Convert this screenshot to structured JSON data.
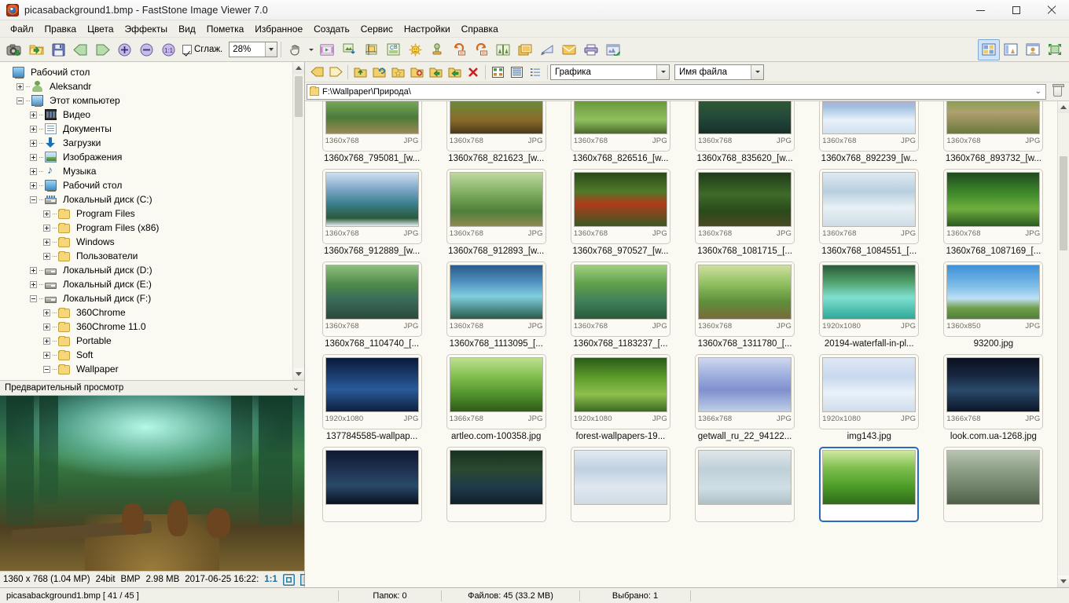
{
  "window": {
    "title": "picasabackground1.bmp  -  FastStone Image Viewer 7.0",
    "app_icon": "camera-icon",
    "minimize_label": "Minimize",
    "maximize_label": "Maximize",
    "close_label": "Close"
  },
  "menubar": {
    "items": [
      {
        "label": "Файл",
        "name": "menu-file"
      },
      {
        "label": "Правка",
        "name": "menu-edit"
      },
      {
        "label": "Цвета",
        "name": "menu-colors"
      },
      {
        "label": "Эффекты",
        "name": "menu-effects"
      },
      {
        "label": "Вид",
        "name": "menu-view"
      },
      {
        "label": "Пометка",
        "name": "menu-tag"
      },
      {
        "label": "Избранное",
        "name": "menu-favorites"
      },
      {
        "label": "Создать",
        "name": "menu-create"
      },
      {
        "label": "Сервис",
        "name": "menu-tools"
      },
      {
        "label": "Настройки",
        "name": "menu-settings"
      },
      {
        "label": "Справка",
        "name": "menu-help"
      }
    ]
  },
  "toolbar": {
    "buttons": [
      {
        "name": "screen-capture-icon",
        "tip": "Захват экрана"
      },
      {
        "name": "open-folder-icon",
        "tip": "Открыть"
      },
      {
        "name": "save-icon",
        "tip": "Сохранить"
      },
      {
        "name": "previous-icon",
        "tip": "Предыдущее"
      },
      {
        "name": "next-icon",
        "tip": "Следующее"
      },
      {
        "name": "zoom-in-icon",
        "tip": "Увеличить"
      },
      {
        "name": "zoom-out-icon",
        "tip": "Уменьшить"
      },
      {
        "name": "actual-size-icon",
        "tip": "Реальный размер"
      }
    ],
    "smooth_checkbox": {
      "label": "Сглаж.",
      "checked": true
    },
    "zoom_value": "28%",
    "buttons2": [
      {
        "name": "pan-hand-icon",
        "tip": "Панорама"
      },
      {
        "name": "slideshow-icon",
        "tip": "Слайд-шоу"
      },
      {
        "name": "resize-icon",
        "tip": "Изменить размер"
      },
      {
        "name": "crop-icon",
        "tip": "Обрезка"
      },
      {
        "name": "color-adjust-icon",
        "tip": "Коррекция цвета"
      },
      {
        "name": "brightness-icon",
        "tip": "Яркость"
      },
      {
        "name": "clone-stamp-icon",
        "tip": "Штамп"
      },
      {
        "name": "rotate-left-icon",
        "tip": "Повернуть влево"
      },
      {
        "name": "rotate-right-icon",
        "tip": "Повернуть вправо"
      },
      {
        "name": "compare-icon",
        "tip": "Сравнить"
      },
      {
        "name": "frame-icon",
        "tip": "Рамка"
      },
      {
        "name": "draw-icon",
        "tip": "Рисование"
      },
      {
        "name": "email-icon",
        "tip": "Отправить по почте"
      },
      {
        "name": "print-icon",
        "tip": "Печать"
      },
      {
        "name": "edit-external-icon",
        "tip": "Внешний редактор"
      }
    ],
    "view_modes": [
      {
        "name": "view-thumbnails-icon",
        "tip": "Эскизы",
        "active": true
      },
      {
        "name": "view-filmstrip-icon",
        "tip": "Плёнка",
        "active": false
      },
      {
        "name": "view-preview-icon",
        "tip": "Просмотр",
        "active": false
      },
      {
        "name": "fullscreen-icon",
        "tip": "Полный экран",
        "active": false
      }
    ]
  },
  "tree": {
    "nodes": [
      {
        "label": "Рабочий стол",
        "depth": 0,
        "icon": "desktop-icon",
        "toggle": "none"
      },
      {
        "label": "Aleksandr",
        "depth": 1,
        "icon": "user-icon",
        "toggle": "plus"
      },
      {
        "label": "Этот компьютер",
        "depth": 1,
        "icon": "computer-icon",
        "toggle": "minus"
      },
      {
        "label": "Видео",
        "depth": 2,
        "icon": "video-icon",
        "toggle": "plus"
      },
      {
        "label": "Документы",
        "depth": 2,
        "icon": "documents-icon",
        "toggle": "plus"
      },
      {
        "label": "Загрузки",
        "depth": 2,
        "icon": "downloads-icon",
        "toggle": "plus"
      },
      {
        "label": "Изображения",
        "depth": 2,
        "icon": "pictures-icon",
        "toggle": "plus"
      },
      {
        "label": "Музыка",
        "depth": 2,
        "icon": "music-icon",
        "toggle": "plus"
      },
      {
        "label": "Рабочий стол",
        "depth": 2,
        "icon": "desktop-icon",
        "toggle": "plus"
      },
      {
        "label": "Локальный диск (C:)",
        "depth": 2,
        "icon": "drive-system-icon",
        "toggle": "minus"
      },
      {
        "label": "Program Files",
        "depth": 3,
        "icon": "folder-icon",
        "toggle": "plus"
      },
      {
        "label": "Program Files (x86)",
        "depth": 3,
        "icon": "folder-icon",
        "toggle": "plus"
      },
      {
        "label": "Windows",
        "depth": 3,
        "icon": "folder-icon",
        "toggle": "plus"
      },
      {
        "label": "Пользователи",
        "depth": 3,
        "icon": "folder-icon",
        "toggle": "plus"
      },
      {
        "label": "Локальный диск (D:)",
        "depth": 2,
        "icon": "drive-icon",
        "toggle": "plus"
      },
      {
        "label": "Локальный диск (E:)",
        "depth": 2,
        "icon": "drive-icon",
        "toggle": "plus"
      },
      {
        "label": "Локальный диск (F:)",
        "depth": 2,
        "icon": "drive-icon",
        "toggle": "minus"
      },
      {
        "label": "360Chrome",
        "depth": 3,
        "icon": "folder-icon",
        "toggle": "plus"
      },
      {
        "label": "360Chrome 11.0",
        "depth": 3,
        "icon": "folder-icon",
        "toggle": "plus"
      },
      {
        "label": "Portable",
        "depth": 3,
        "icon": "folder-icon",
        "toggle": "plus"
      },
      {
        "label": "Soft",
        "depth": 3,
        "icon": "folder-icon",
        "toggle": "plus"
      },
      {
        "label": "Wallpaper",
        "depth": 3,
        "icon": "folder-icon",
        "toggle": "minus"
      }
    ]
  },
  "preview": {
    "header_label": "Предварительный просмотр",
    "collapse_icon": "double-chevron-down-icon",
    "status": {
      "dimensions": "1360 x 768 (1.04 MP)",
      "depth": "24bit",
      "format": "BMP",
      "size": "2.98 MB",
      "date": "2017-06-25 16:22:",
      "ratio": "1:1",
      "fit_icon": "fit-window-icon",
      "full_icon": "full-size-icon"
    }
  },
  "browser": {
    "nav_buttons": [
      {
        "name": "back-arrow-icon",
        "tip": "Назад"
      },
      {
        "name": "forward-arrow-icon",
        "tip": "Вперёд"
      }
    ],
    "folder_buttons": [
      {
        "name": "folder-up-icon",
        "tip": "Вверх"
      },
      {
        "name": "folder-refresh-icon",
        "tip": "Обновить"
      },
      {
        "name": "folder-favorite-icon",
        "tip": "Избранная папка"
      },
      {
        "name": "folder-new-icon",
        "tip": "Новая папка"
      },
      {
        "name": "folder-copy-to-icon",
        "tip": "Копировать в"
      },
      {
        "name": "folder-move-to-icon",
        "tip": "Переместить в"
      }
    ],
    "delete_x_icon": "delete-x-icon",
    "list_buttons": [
      {
        "name": "view-grid-icon",
        "tip": "Эскизы"
      },
      {
        "name": "view-list-icon",
        "tip": "Список"
      },
      {
        "name": "view-details-icon",
        "tip": "Подробно"
      }
    ],
    "filter_combo": {
      "value": "Графика",
      "name": "file-type-filter"
    },
    "sort_combo": {
      "value": "Имя файла",
      "name": "sort-order-select"
    },
    "address": {
      "value": "F:\\Wallpaper\\Природа\\",
      "folder_icon": "folder-icon",
      "dropdown_icon": "chevron-down-icon"
    },
    "delete_button": {
      "name": "delete-button",
      "icon": "trash-icon"
    }
  },
  "thumbnails": [
    {
      "size": "1360x768",
      "type": "JPG",
      "name": "1360x768_795081_[w...",
      "selected": false,
      "art": "path-forest"
    },
    {
      "size": "1360x768",
      "type": "JPG",
      "name": "1360x768_821623_[w...",
      "selected": false,
      "art": "mushroom-forest"
    },
    {
      "size": "1360x768",
      "type": "JPG",
      "name": "1360x768_826516_[w...",
      "selected": false,
      "art": "green-park"
    },
    {
      "size": "1360x768",
      "type": "JPG",
      "name": "1360x768_835620_[w...",
      "selected": false,
      "art": "dark-lake"
    },
    {
      "size": "1360x768",
      "type": "JPG",
      "name": "1360x768_892239_[w...",
      "selected": false,
      "art": "winter-pink-sky"
    },
    {
      "size": "1360x768",
      "type": "JPG",
      "name": "1360x768_893732_[w...",
      "selected": false,
      "art": "stone-cottage"
    },
    {
      "size": "1360x768",
      "type": "JPG",
      "name": "1360x768_912889_[w...",
      "selected": false,
      "art": "snow-lake-pine"
    },
    {
      "size": "1360x768",
      "type": "JPG",
      "name": "1360x768_912893_[w...",
      "selected": false,
      "art": "green-road"
    },
    {
      "size": "1360x768",
      "type": "JPG",
      "name": "1360x768_970527_[w...",
      "selected": false,
      "art": "red-pagoda"
    },
    {
      "size": "1360x768",
      "type": "JPG",
      "name": "1360x768_1081715_[...",
      "selected": false,
      "art": "forest-trail"
    },
    {
      "size": "1360x768",
      "type": "JPG",
      "name": "1360x768_1084551_[...",
      "selected": false,
      "art": "snow-cabin"
    },
    {
      "size": "1360x768",
      "type": "JPG",
      "name": "1360x768_1087169_[...",
      "selected": false,
      "art": "jungle-green"
    },
    {
      "size": "1360x768",
      "type": "JPG",
      "name": "1360x768_1104740_[...",
      "selected": false,
      "art": "marsh-reflection"
    },
    {
      "size": "1360x768",
      "type": "JPG",
      "name": "1360x768_1113095_[...",
      "selected": false,
      "art": "blue-waterfall"
    },
    {
      "size": "1360x768",
      "type": "JPG",
      "name": "1360x768_1183237_[...",
      "selected": false,
      "art": "green-pond"
    },
    {
      "size": "1360x768",
      "type": "JPG",
      "name": "1360x768_1311780_[...",
      "selected": false,
      "art": "stump-meadow"
    },
    {
      "size": "1920x1080",
      "type": "JPG",
      "name": "20194-waterfall-in-pl...",
      "selected": false,
      "art": "teal-waterfall"
    },
    {
      "size": "1360x850",
      "type": "JPG",
      "name": "93200.jpg",
      "selected": false,
      "art": "lone-tree-sky"
    },
    {
      "size": "1920x1080",
      "type": "JPG",
      "name": "1377845585-wallpap...",
      "selected": false,
      "art": "night-lake"
    },
    {
      "size": "1366x768",
      "type": "JPG",
      "name": "artleo.com-100358.jpg",
      "selected": false,
      "art": "sunlit-green"
    },
    {
      "size": "1920x1080",
      "type": "JPG",
      "name": "forest-wallpapers-19...",
      "selected": false,
      "art": "mossy-forest"
    },
    {
      "size": "1366x768",
      "type": "JPG",
      "name": "getwall_ru_22_94122...",
      "selected": false,
      "art": "blue-snow-river"
    },
    {
      "size": "1920x1080",
      "type": "JPG",
      "name": "img143.jpg",
      "selected": false,
      "art": "winter-moon"
    },
    {
      "size": "1366x768",
      "type": "JPG",
      "name": "look.com.ua-1268.jpg",
      "selected": false,
      "art": "moonlit-sea"
    },
    {
      "size": "",
      "type": "",
      "name": "",
      "selected": false,
      "art": "night-moon-row"
    },
    {
      "size": "",
      "type": "",
      "name": "",
      "selected": false,
      "art": "dark-water-row"
    },
    {
      "size": "",
      "type": "",
      "name": "",
      "selected": false,
      "art": "frost-tree-row"
    },
    {
      "size": "",
      "type": "",
      "name": "",
      "selected": false,
      "art": "pale-forest-row"
    },
    {
      "size": "",
      "type": "",
      "name": "",
      "selected": true,
      "art": "bright-green-row"
    },
    {
      "size": "",
      "type": "",
      "name": "",
      "selected": false,
      "art": "grey-forest-row"
    }
  ],
  "statusbar": {
    "file": "picasabackground1.bmp [ 41 / 45 ]",
    "folders": "Папок: 0",
    "files": "Файлов: 45 (33.2 MB)",
    "selected": "Выбрано: 1"
  },
  "colors": {
    "accent": "#2a6bbf",
    "panel": "#f0efe8",
    "content": "#faf9f2",
    "close_hover": "#e81123"
  }
}
